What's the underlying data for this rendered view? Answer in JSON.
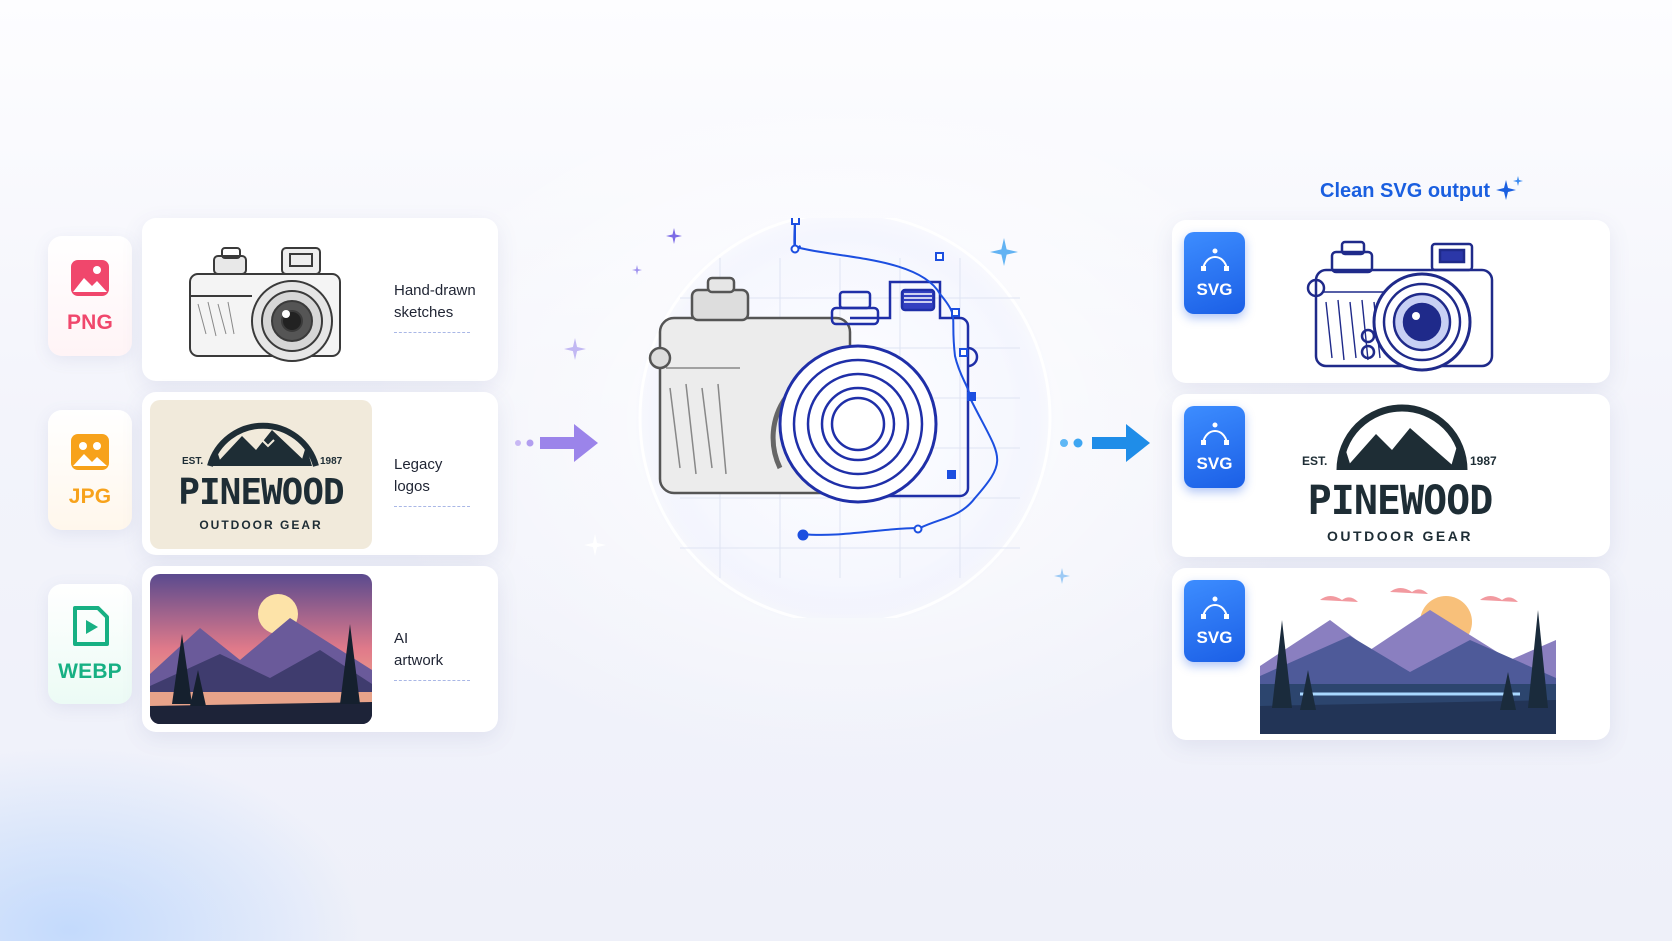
{
  "inputs": [
    {
      "format": "PNG",
      "color": "#f0476c",
      "caption_line1": "Hand-drawn",
      "caption_line2": "sketches"
    },
    {
      "format": "JPG",
      "color": "#f7a21b",
      "caption_line1": "Legacy",
      "caption_line2": "logos"
    },
    {
      "format": "WEBP",
      "color": "#17b083",
      "caption_line1": "AI",
      "caption_line2": "artwork"
    }
  ],
  "logo": {
    "name": "PINEWOOD",
    "tagline": "OUTDOOR GEAR",
    "est": "EST.",
    "year": "1987"
  },
  "output": {
    "title": "Clean SVG output",
    "chip_label": "SVG",
    "accent": "#1a5fe0"
  },
  "icons": {
    "png": "image-icon",
    "jpg": "image-icon",
    "webp": "video-play-icon",
    "svg": "vector-path-icon",
    "sparkle": "sparkle-icon"
  }
}
